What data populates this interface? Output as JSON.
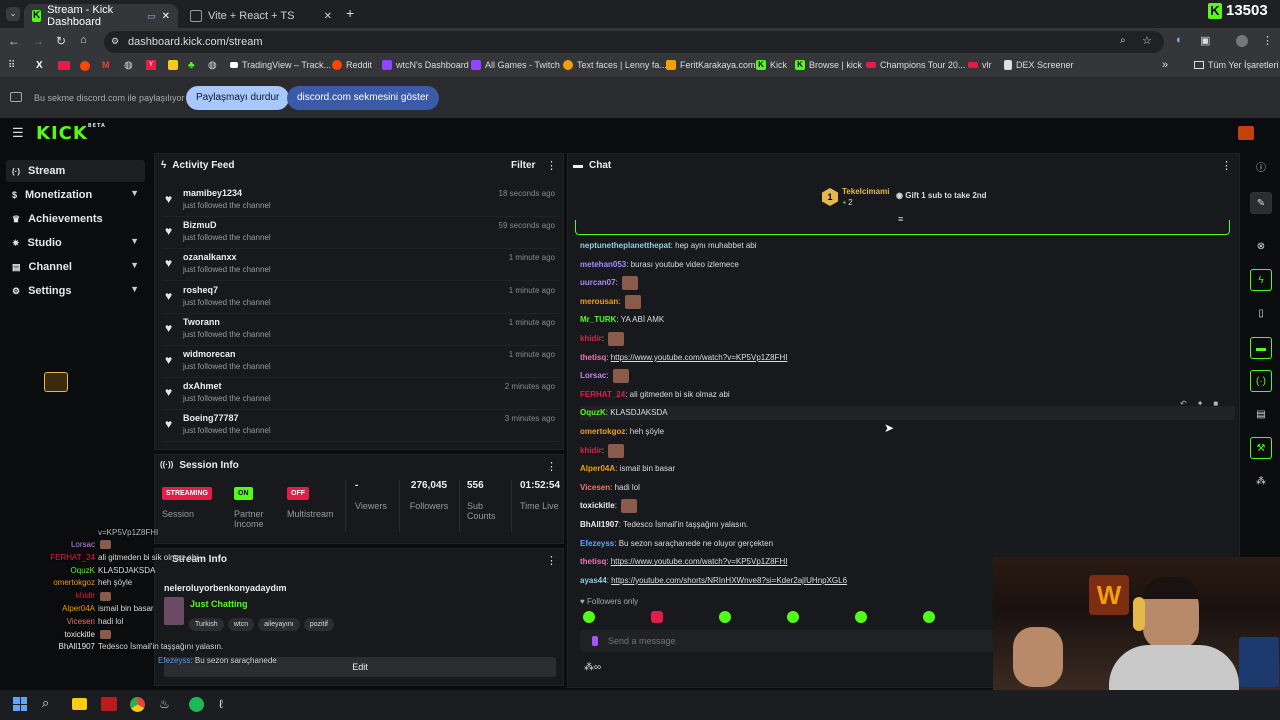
{
  "browser": {
    "tabs": [
      {
        "title": "Stream - Kick Dashboard"
      },
      {
        "title": "Vite + React + TS"
      }
    ],
    "url": "dashboard.kick.com/stream",
    "bookmarks": [
      "TradingView – Track...",
      "Reddit",
      "wtcN's Dashboard",
      "All Games - Twitch",
      "Text faces | Lenny fa...",
      "FeritKarakaya.com",
      "Kick",
      "Browse | kick",
      "Champions Tour 20...",
      "vlr",
      "DEX Screener",
      "Tüm Yer İşaretleri"
    ],
    "share": {
      "text": "Bu sekme discord.com ile paylaşılıyor",
      "stop": "Paylaşmayı durdur",
      "show": "discord.com sekmesini göster"
    },
    "overlay_counter": "13503"
  },
  "kick": {
    "logo": "KICK",
    "logo_badge": "BETA",
    "sidebar": [
      {
        "label": "Stream"
      },
      {
        "label": "Monetization"
      },
      {
        "label": "Achievements"
      },
      {
        "label": "Studio"
      },
      {
        "label": "Channel"
      },
      {
        "label": "Settings"
      }
    ],
    "activity": {
      "title": "Activity Feed",
      "filter": "Filter",
      "items": [
        {
          "name": "mamibey1234",
          "sub": "just followed the channel",
          "time": "18 seconds ago"
        },
        {
          "name": "BizmuD",
          "sub": "just followed the channel",
          "time": "59 seconds ago"
        },
        {
          "name": "ozanalkanxx",
          "sub": "just followed the channel",
          "time": "1 minute ago"
        },
        {
          "name": "rosheq7",
          "sub": "just followed the channel",
          "time": "1 minute ago"
        },
        {
          "name": "Tworann",
          "sub": "just followed the channel",
          "time": "1 minute ago"
        },
        {
          "name": "widmorecan",
          "sub": "just followed the channel",
          "time": "1 minute ago"
        },
        {
          "name": "dxAhmet",
          "sub": "just followed the channel",
          "time": "2 minutes ago"
        },
        {
          "name": "Boeing77787",
          "sub": "just followed the channel",
          "time": "3 minutes ago"
        }
      ]
    },
    "session": {
      "title": "Session Info",
      "stream_badge": "STREAMING",
      "stream_label": "Session",
      "partner_badge": "ON",
      "partner_label": "Partner Income",
      "multi_badge": "OFF",
      "multi_label": "Multistream",
      "viewers": "-",
      "viewers_label": "Viewers",
      "followers": "276,045",
      "followers_label": "Followers",
      "subs": "556",
      "subs_label": "Sub Counts",
      "time": "01:52:54",
      "time_label": "Time Live"
    },
    "stream_info": {
      "title": "Stream Info",
      "stream_title": "neleroluyorbenkonyadaydım",
      "category": "Just Chatting",
      "tags": [
        "Turkish",
        "wtcn",
        "aileyayını",
        "pozitif"
      ],
      "edit": "Edit"
    },
    "chat": {
      "title": "Chat",
      "top_gifter": "Tekelcimami",
      "top_count": "2",
      "gift_text": "Gift 1 sub to take 2nd",
      "messages": [
        {
          "user": "neptunetheplanetthepat",
          "color": "#8fd0e0",
          "text": "hep aynı muhabbet abi",
          "link": false
        },
        {
          "user": "metehan053",
          "color": "#a78bfa",
          "text": "burası youtube video izlemece",
          "link": false
        },
        {
          "user": "uurcan07",
          "color": "#a78bfa",
          "text": "",
          "link": false,
          "emote": true
        },
        {
          "user": "merousan",
          "color": "#f59e0b",
          "text": "",
          "link": false,
          "emote": true
        },
        {
          "user": "Mr_TURK",
          "color": "#53fc18",
          "text": "YA ABİ AMK",
          "link": false
        },
        {
          "user": "khidir",
          "color": "#e11d48",
          "text": "",
          "link": false,
          "emote": true
        },
        {
          "user": "thetisq",
          "color": "#f472b6",
          "text": "https://www.youtube.com/watch?v=KP5Vp1Z8FHI",
          "link": true
        },
        {
          "user": "Lorsac",
          "color": "#c084fc",
          "text": "",
          "link": false,
          "emote": true
        },
        {
          "user": "FERHAT_24",
          "color": "#e11d48",
          "text": "ali gitmeden bi sik olmaz abi",
          "link": false
        },
        {
          "user": "OquzK",
          "color": "#53fc18",
          "text": "KLASDJAKSDA",
          "link": false
        },
        {
          "user": "omertokgoz",
          "color": "#f59e0b",
          "text": "heh şöyle",
          "link": false
        },
        {
          "user": "khidir",
          "color": "#e11d48",
          "text": "",
          "link": false,
          "emote": true
        },
        {
          "user": "Alper04A",
          "color": "#f59e0b",
          "text": "ismail bin basar",
          "link": false
        },
        {
          "user": "Vicesen",
          "color": "#f87171",
          "text": "hadi lol",
          "link": false
        },
        {
          "user": "toxickitle",
          "color": "#eee",
          "text": "",
          "link": false,
          "emote": true
        },
        {
          "user": "BhAll1907",
          "color": "#eee",
          "text": "Tedesco İsmail'in taşşağını yalasın.",
          "link": false
        },
        {
          "user": "Efezeyss",
          "color": "#60a5fa",
          "text": "Bu sezon saraçhanede ne oluyor gerçekten",
          "link": false
        },
        {
          "user": "thetisq",
          "color": "#f472b6",
          "text": "https://www.youtube.com/watch?v=KP5Vp1Z8FHI",
          "link": true
        },
        {
          "user": "ayas44",
          "color": "#8fd0e0",
          "text": "https://youtube.com/shorts/NRInHXWnve8?si=Kder2ajIUHnpXGL6",
          "link": true
        }
      ],
      "followers_only": "Followers only",
      "placeholder": "Send a message"
    },
    "overlay": [
      {
        "user": "Lorsac",
        "color": "#c084fc",
        "text": ""
      },
      {
        "user": "FERHAT_24",
        "color": "#e11d48",
        "text": "ali gitmeden bi sik olmaz abi"
      },
      {
        "user": "OquzK",
        "color": "#53fc18",
        "text": "KLASDJAKSDA"
      },
      {
        "user": "omertokgoz",
        "color": "#f59e0b",
        "text": "heh şöyle"
      },
      {
        "user": "khidir",
        "color": "#e11d48",
        "text": ""
      },
      {
        "user": "Alper04A",
        "color": "#f59e0b",
        "text": "ismail bin basar"
      },
      {
        "user": "Vicesen",
        "color": "#f87171",
        "text": "hadi lol"
      },
      {
        "user": "toxickitle",
        "color": "#eee",
        "text": ""
      },
      {
        "user": "BhAll1907",
        "color": "#eee",
        "text": "Tedesco İsmail'in taşşağını yalasın."
      }
    ],
    "overlay_partial": "Bu sezon saraçhanede",
    "overlay_top": "v=KP5Vp1Z8FHI"
  },
  "colors": {
    "accent": "#53fc18",
    "streaming": "#e11d48"
  }
}
